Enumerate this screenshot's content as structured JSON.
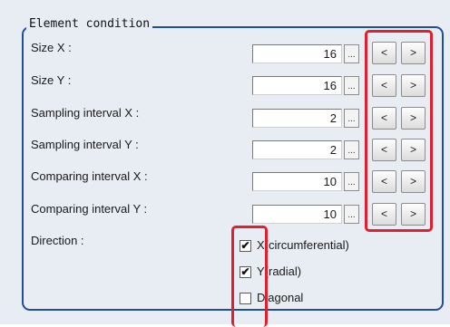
{
  "group": {
    "title": "Element condition"
  },
  "rows": [
    {
      "label": "Size X :",
      "value": "16"
    },
    {
      "label": "Size Y :",
      "value": "16"
    },
    {
      "label": "Sampling interval X :",
      "value": "2"
    },
    {
      "label": "Sampling interval Y :",
      "value": "2"
    },
    {
      "label": "Comparing interval X :",
      "value": "10"
    },
    {
      "label": "Comparing interval Y :",
      "value": "10"
    }
  ],
  "buttons": {
    "ellipsis": "...",
    "decrease": "<",
    "increase": ">"
  },
  "direction": {
    "label": "Direction :",
    "check_mark": "✔",
    "options": [
      {
        "label": "X(circumferential)",
        "checked": true
      },
      {
        "label": "Y(radial)",
        "checked": true
      },
      {
        "label": "Diagonal",
        "checked": false
      }
    ]
  },
  "colors": {
    "highlight": "#e0202e",
    "group_border": "#1e4f9c",
    "panel_bg": "#e8ecf3"
  }
}
